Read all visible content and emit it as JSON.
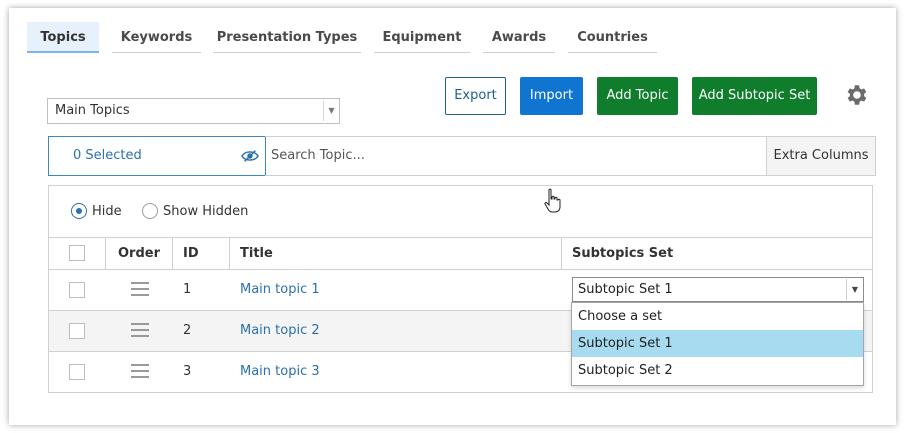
{
  "tabs": [
    {
      "label": "Topics",
      "active": true
    },
    {
      "label": "Keywords"
    },
    {
      "label": "Presentation Types"
    },
    {
      "label": "Equipment"
    },
    {
      "label": "Awards"
    },
    {
      "label": "Countries"
    }
  ],
  "topic_group_select": {
    "value": "Main Topics"
  },
  "toolbar": {
    "export_label": "Export",
    "import_label": "Import",
    "add_topic_label": "Add Topic",
    "add_subtopic_set_label": "Add Subtopic Set",
    "settings_icon": "gear-icon"
  },
  "selection": {
    "count_text": "0 Selected",
    "visibility_icon": "eye-slash-icon"
  },
  "search": {
    "placeholder": "Search Topic..."
  },
  "extra_columns_label": "Extra Columns",
  "visibility_filter": {
    "options": [
      {
        "label": "Hide",
        "checked": true
      },
      {
        "label": "Show Hidden",
        "checked": false
      }
    ]
  },
  "table": {
    "columns": [
      "Order",
      "ID",
      "Title",
      "Subtopics Set"
    ],
    "rows": [
      {
        "id": "1",
        "title": "Main topic 1"
      },
      {
        "id": "2",
        "title": "Main topic 2"
      },
      {
        "id": "3",
        "title": "Main topic 3"
      }
    ]
  },
  "subtopic_dropdown": {
    "value": "Subtopic Set 1",
    "options": [
      "Choose a set",
      "Subtopic Set 1",
      "Subtopic Set 2"
    ],
    "highlighted": "Subtopic Set 1"
  },
  "colors": {
    "primary_blue": "#0f75d1",
    "green": "#0f7d2c",
    "link": "#2c70ad",
    "highlight": "#a6dbf0"
  }
}
